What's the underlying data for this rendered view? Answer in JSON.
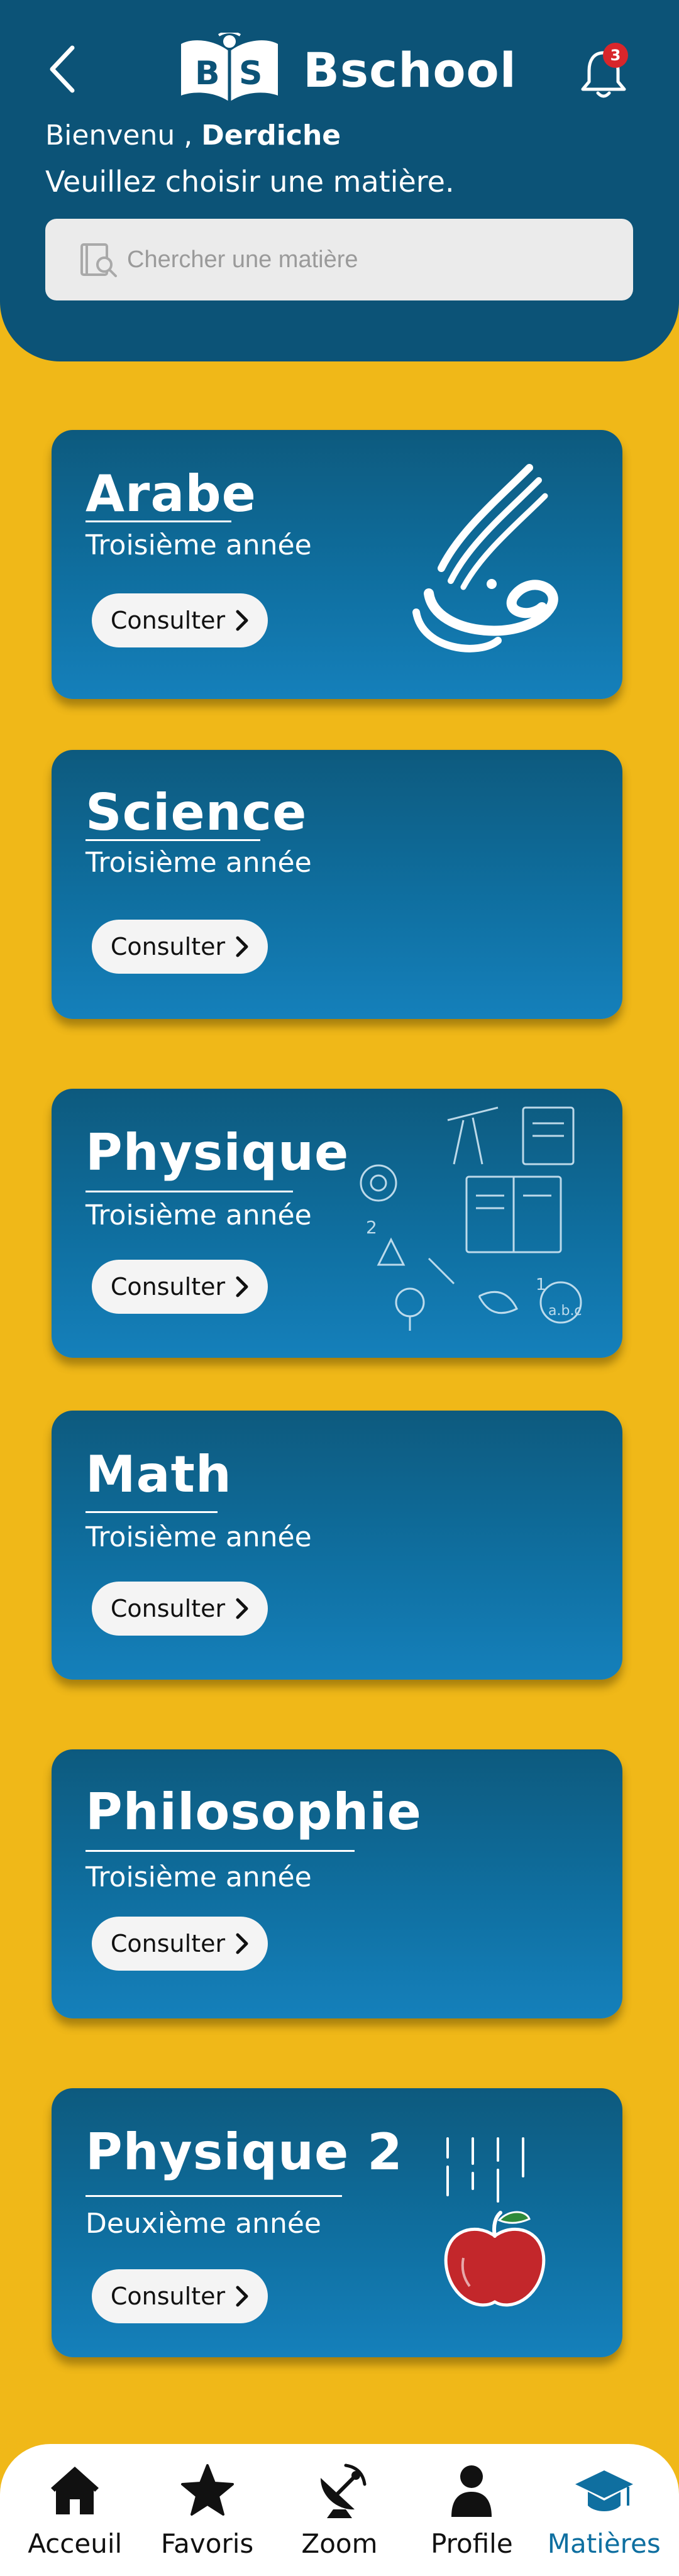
{
  "app": {
    "title": "Bschool",
    "logo_letters": [
      "B",
      "S"
    ],
    "notification_count": "3"
  },
  "header": {
    "welcome_prefix": "Bienvenu ,",
    "user_name": "Derdiche",
    "instruction": "Veuillez choisir une matière."
  },
  "search": {
    "placeholder": "Chercher une matière"
  },
  "subjects": [
    {
      "title": "Arabe",
      "year": "Troisième année",
      "button": "Consulter",
      "art": "arabic-calligraphy"
    },
    {
      "title": "Science",
      "year": "Troisième année",
      "button": "Consulter",
      "art": ""
    },
    {
      "title": "Physique",
      "year": "Troisième année",
      "button": "Consulter",
      "art": "science-doodles"
    },
    {
      "title": "Math",
      "year": "Troisième année",
      "button": "Consulter",
      "art": ""
    },
    {
      "title": "Philosophie",
      "year": "Troisième année",
      "button": "Consulter",
      "art": ""
    },
    {
      "title": "Physique 2",
      "year": "Deuxième année",
      "button": "Consulter",
      "art": "falling-apple"
    }
  ],
  "nav": [
    {
      "label": "Acceuil",
      "icon": "home-icon",
      "active": false
    },
    {
      "label": "Favoris",
      "icon": "star-icon",
      "active": false
    },
    {
      "label": "Zoom",
      "icon": "satellite-icon",
      "active": false
    },
    {
      "label": "Profile",
      "icon": "person-icon",
      "active": false
    },
    {
      "label": "Matières",
      "icon": "graduation-cap-icon",
      "active": true
    }
  ],
  "colors": {
    "background": "#f0b818",
    "header": "#0c5377",
    "card_top": "#0d5a7e",
    "card_bottom": "#1580bb",
    "badge": "#d8262b",
    "active_nav": "#0f6fa0"
  }
}
